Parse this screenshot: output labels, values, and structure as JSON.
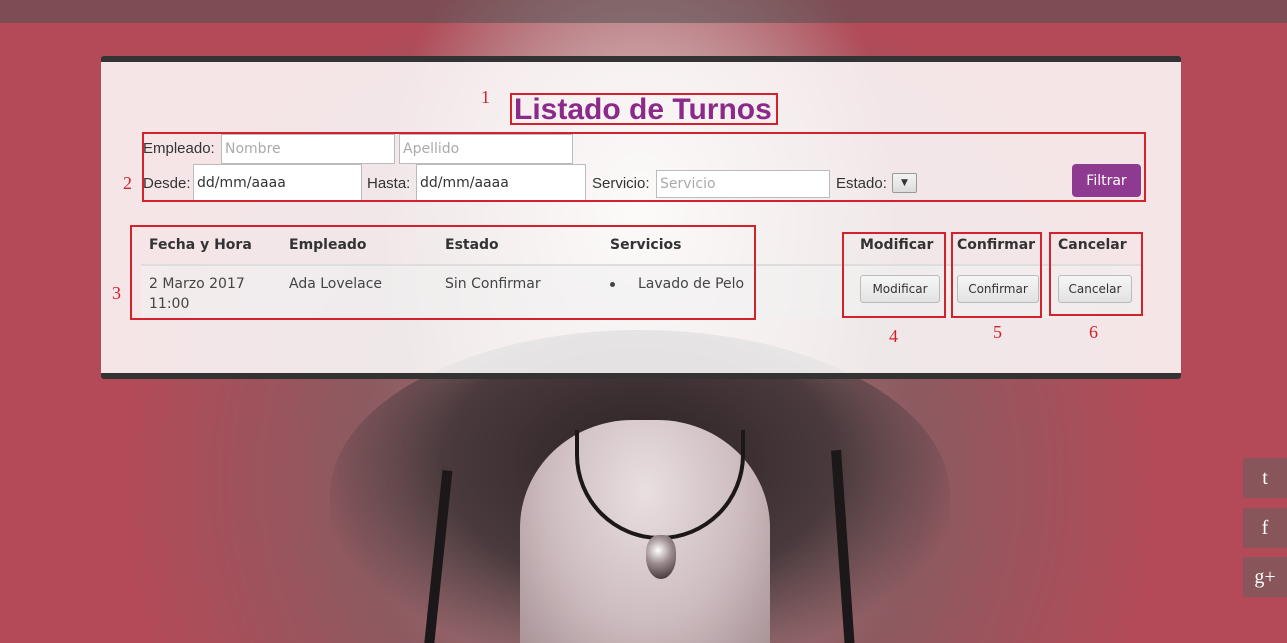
{
  "page": {
    "title": "Listado de Turnos"
  },
  "filters": {
    "empleado_label": "Empleado:",
    "nombre_placeholder": "Nombre",
    "apellido_placeholder": "Apellido",
    "desde_label": "Desde:",
    "desde_value": "dd/mm/aaaa",
    "hasta_label": "Hasta:",
    "hasta_value": "dd/mm/aaaa",
    "servicio_label": "Servicio:",
    "servicio_placeholder": "Servicio",
    "estado_label": "Estado:",
    "estado_value": "",
    "filter_button": "Filtrar"
  },
  "table": {
    "headers": [
      "Fecha y Hora",
      "Empleado",
      "Estado",
      "Servicios",
      "Modificar",
      "Confirmar",
      "Cancelar"
    ],
    "rows": [
      {
        "fecha_line1": "2 Marzo 2017",
        "fecha_line2": "11:00",
        "empleado": "Ada Lovelace",
        "estado": "Sin Confirmar",
        "servicios": [
          "Lavado de Pelo"
        ],
        "modificar": "Modificar",
        "confirmar": "Confirmar",
        "cancelar": "Cancelar"
      }
    ]
  },
  "annotations": [
    "1",
    "2",
    "3",
    "4",
    "5",
    "6"
  ],
  "social": {
    "twitter": "t",
    "facebook": "f",
    "googleplus": "g+"
  },
  "colors": {
    "title": "#8b2a88",
    "filter_button": "#8e3a90",
    "annotation": "#d2232a"
  }
}
